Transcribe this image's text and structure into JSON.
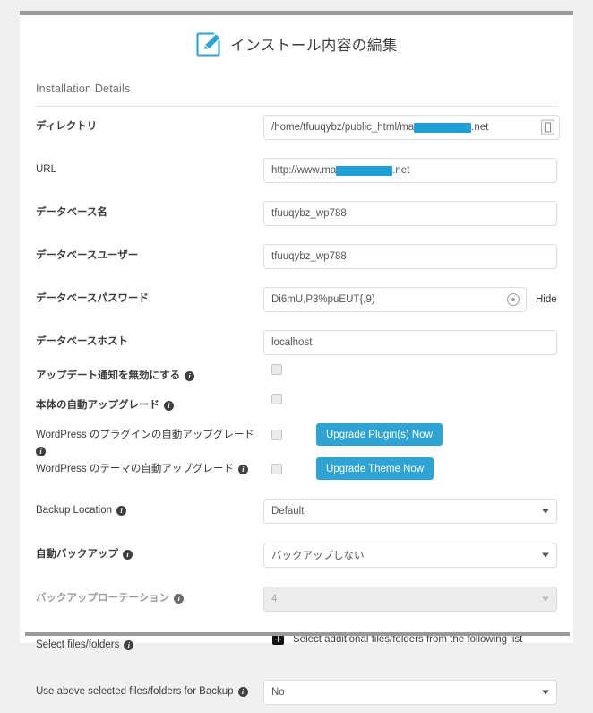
{
  "page": {
    "title": "インストール内容の編集",
    "title_icon": "edit-pencil-icon",
    "section_heading": "Installation Details"
  },
  "fields": {
    "directory": {
      "label": "ディレクトリ",
      "value_prefix": "/home/tfuuqybz/public_html/ma",
      "value_suffix": ".net",
      "redacted": true,
      "button_icon": "directory-browse-icon"
    },
    "url": {
      "label": "URL",
      "value_prefix": "http://www.ma",
      "value_suffix": ".net",
      "redacted": true
    },
    "database_name": {
      "label": "データベース名",
      "value": "tfuuqybz_wp788"
    },
    "database_user": {
      "label": "データベースユーザー",
      "value": "tfuuqybz_wp788"
    },
    "database_password": {
      "label": "データベースパスワード",
      "value": "Di6mU,P3%puEUT{,9)",
      "hide_label": "Hide",
      "eye_icon": "show-password-icon"
    },
    "database_host": {
      "label": "データベースホスト",
      "value": "localhost"
    },
    "disable_update_notify": {
      "label": "アップデート通知を無効にする",
      "checked": false,
      "info_icon": "info-icon"
    },
    "auto_upgrade_core": {
      "label": "本体の自動アップグレード",
      "checked": false,
      "info_icon": "info-icon"
    },
    "auto_upgrade_plugins": {
      "label": "WordPress のプラグインの自動アップグレード",
      "checked": false,
      "info_icon": "info-icon",
      "button_label": "Upgrade Plugin(s) Now"
    },
    "auto_upgrade_themes": {
      "label": "WordPress のテーマの自動アップグレード",
      "checked": false,
      "info_icon": "info-icon",
      "button_label": "Upgrade Theme Now"
    },
    "backup_location": {
      "label": "Backup Location",
      "value": "Default",
      "info_icon": "info-icon"
    },
    "auto_backup": {
      "label": "自動バックアップ",
      "value": "バックアップしない",
      "info_icon": "info-icon"
    },
    "backup_rotation": {
      "label": "バックアップローテーション",
      "value": "4",
      "disabled": true,
      "info_icon": "info-icon"
    },
    "select_files_folders": {
      "label": "Select files/folders",
      "action_text": "Select additional files/folders from the following list",
      "plus_icon": "plus-square-icon",
      "info_icon": "info-icon"
    },
    "use_selected_for_backup": {
      "label": "Use above selected files/folders for Backup",
      "value": "No",
      "info_icon": "info-icon"
    }
  },
  "colors": {
    "accent_blue": "#2ea3d4",
    "redaction_blue": "#1f9ed8",
    "panel_bg": "#ffffff",
    "page_bg": "#f0f0f0",
    "rule_gray": "#9a9a9a"
  }
}
